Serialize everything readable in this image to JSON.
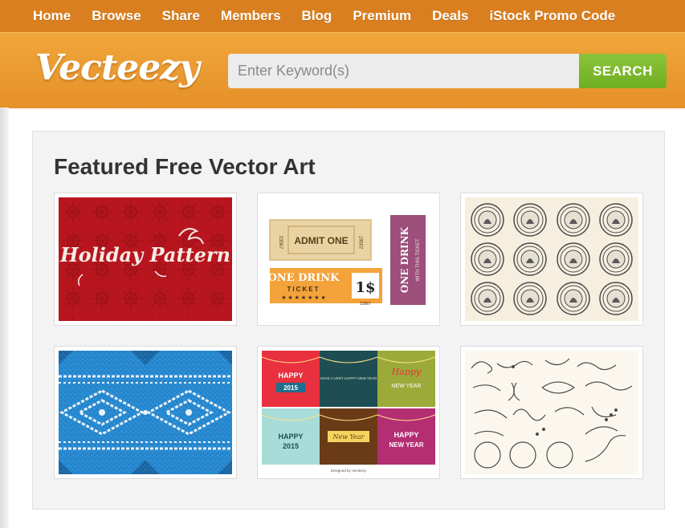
{
  "nav": {
    "items": [
      "Home",
      "Browse",
      "Share",
      "Members",
      "Blog",
      "Premium",
      "Deals",
      "iStock Promo Code"
    ]
  },
  "header": {
    "logo_text": "Vecteezy",
    "search_placeholder": "Enter Keyword(s)",
    "search_button": "SEARCH"
  },
  "featured": {
    "title": "Featured Free Vector Art",
    "items": [
      {
        "name": "Holiday Pattern",
        "caption": "Holiday Pattern"
      },
      {
        "name": "tickets",
        "admit": "ADMIT ONE",
        "drink": "ONE DRINK",
        "ticket": "TICKET",
        "price": "1$",
        "drink2": "ONE DRINK",
        "with_ticket": "WITH THIS TICKET",
        "serial1": "23567",
        "serial2": "23567",
        "serial3": "23567"
      },
      {
        "name": "badges"
      },
      {
        "name": "knit-pattern"
      },
      {
        "name": "new-year-cards",
        "happy": "HAPPY",
        "year_2015": "2015",
        "happy_new_year": "HAVE A VERY HAPPY NEW YEAR",
        "new_year": "NEW YEAR",
        "happy2": "HAPPY",
        "year2": "2015",
        "happy3": "HAPPY",
        "new_year2": "NEW YEAR",
        "credit": "Designed by Vecteezy"
      },
      {
        "name": "ornaments"
      }
    ]
  },
  "colors": {
    "nav_bg": "#d97f1f",
    "header_bg": "#e9962e",
    "search_btn": "#7cb82f",
    "panel_bg": "#f3f3f3"
  }
}
